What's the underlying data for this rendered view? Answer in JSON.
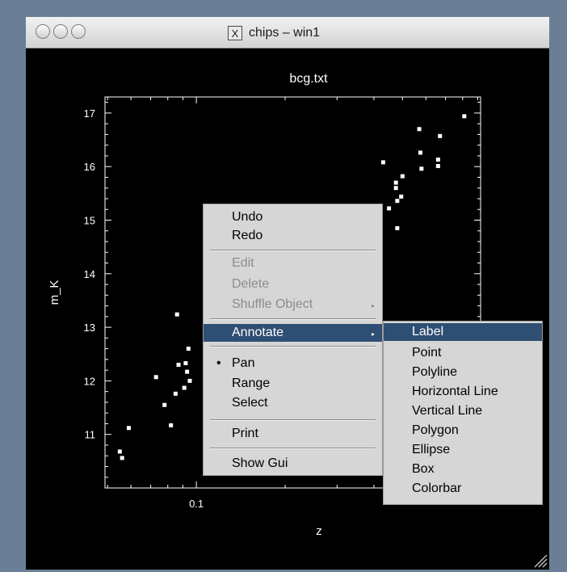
{
  "window": {
    "title": "chips – win1"
  },
  "chart_data": {
    "type": "scatter",
    "title": "bcg.txt",
    "xlabel": "z",
    "ylabel": "m_K",
    "x_scale": "log",
    "xlim": [
      0.049,
      0.92
    ],
    "ylim": [
      10.0,
      17.3
    ],
    "x_ticks": [
      0.1
    ],
    "x_tick_labels": [
      "0.1"
    ],
    "y_ticks": [
      11,
      12,
      13,
      14,
      15,
      16,
      17
    ],
    "y_tick_labels": [
      "11",
      "12",
      "13",
      "14",
      "15",
      "16",
      "17"
    ],
    "points": [
      {
        "x": 0.055,
        "y": 10.68
      },
      {
        "x": 0.056,
        "y": 10.56
      },
      {
        "x": 0.059,
        "y": 11.12
      },
      {
        "x": 0.073,
        "y": 12.07
      },
      {
        "x": 0.078,
        "y": 11.55
      },
      {
        "x": 0.082,
        "y": 11.17
      },
      {
        "x": 0.085,
        "y": 11.76
      },
      {
        "x": 0.086,
        "y": 13.24
      },
      {
        "x": 0.087,
        "y": 12.3
      },
      {
        "x": 0.091,
        "y": 11.87
      },
      {
        "x": 0.093,
        "y": 12.17
      },
      {
        "x": 0.094,
        "y": 12.6
      },
      {
        "x": 0.092,
        "y": 12.33
      },
      {
        "x": 0.095,
        "y": 12.0
      },
      {
        "x": 0.43,
        "y": 16.08
      },
      {
        "x": 0.45,
        "y": 15.22
      },
      {
        "x": 0.475,
        "y": 15.6
      },
      {
        "x": 0.475,
        "y": 15.7
      },
      {
        "x": 0.48,
        "y": 15.36
      },
      {
        "x": 0.48,
        "y": 14.85
      },
      {
        "x": 0.495,
        "y": 15.44
      },
      {
        "x": 0.5,
        "y": 15.82
      },
      {
        "x": 0.57,
        "y": 16.7
      },
      {
        "x": 0.575,
        "y": 16.26
      },
      {
        "x": 0.58,
        "y": 15.96
      },
      {
        "x": 0.66,
        "y": 16.13
      },
      {
        "x": 0.66,
        "y": 16.01
      },
      {
        "x": 0.67,
        "y": 16.57
      },
      {
        "x": 0.81,
        "y": 16.94
      }
    ],
    "colors": {
      "background": "#000000",
      "points": "#ffffff",
      "axes": "#ffffff"
    }
  },
  "context_menu": {
    "items": [
      {
        "label": "Undo",
        "enabled": true
      },
      {
        "label": "Redo",
        "enabled": true
      },
      {
        "label": "Edit",
        "enabled": false
      },
      {
        "label": "Delete",
        "enabled": false
      },
      {
        "label": "Shuffle Object",
        "enabled": false,
        "submenu": true
      },
      {
        "label": "Annotate",
        "enabled": true,
        "submenu": true,
        "highlighted": true
      },
      {
        "label": "Pan",
        "enabled": true,
        "checked": true
      },
      {
        "label": "Range",
        "enabled": true
      },
      {
        "label": "Select",
        "enabled": true
      },
      {
        "label": "Print",
        "enabled": true
      },
      {
        "label": "Show Gui",
        "enabled": true
      }
    ],
    "bullet": "•",
    "submenu_arrow": "▸"
  },
  "annotate_submenu": {
    "items": [
      {
        "label": "Label",
        "highlighted": true
      },
      {
        "label": "Point"
      },
      {
        "label": "Polyline"
      },
      {
        "label": "Horizontal Line"
      },
      {
        "label": "Vertical Line"
      },
      {
        "label": "Polygon"
      },
      {
        "label": "Ellipse"
      },
      {
        "label": "Box"
      },
      {
        "label": "Colorbar"
      }
    ]
  },
  "icons": {
    "x11": "X",
    "close": "traffic-light",
    "resize": "resize-grip"
  }
}
